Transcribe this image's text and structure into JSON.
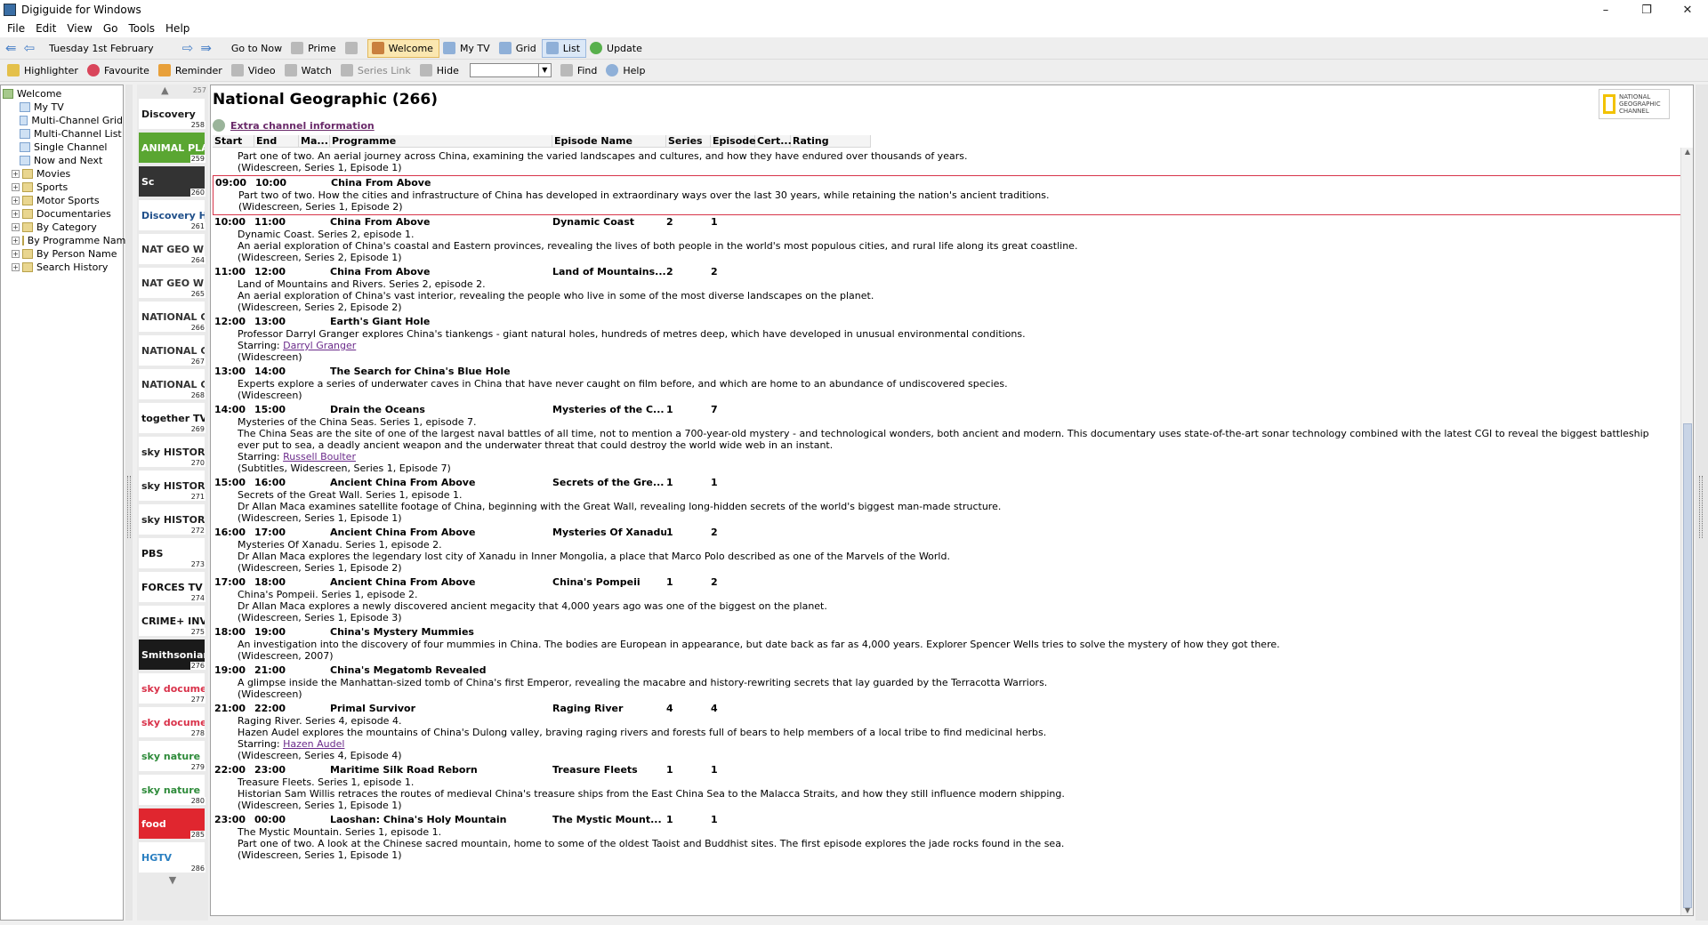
{
  "window": {
    "title": "Digiguide for Windows",
    "minimize": "–",
    "restore": "❐",
    "close": "✕"
  },
  "menu": [
    "File",
    "Edit",
    "View",
    "Go",
    "Tools",
    "Help"
  ],
  "toolbar1": {
    "date": "Tuesday 1st February",
    "go_to_now": "Go to Now",
    "prime": "Prime",
    "welcome": "Welcome",
    "my_tv": "My TV",
    "grid": "Grid",
    "list": "List",
    "update": "Update"
  },
  "toolbar2": {
    "highlighter": "Highlighter",
    "favourite": "Favourite",
    "reminder": "Reminder",
    "video": "Video",
    "watch": "Watch",
    "series_link": "Series Link",
    "hide": "Hide",
    "find": "Find",
    "help": "Help"
  },
  "tree": [
    {
      "label": "Welcome",
      "level": 0,
      "icon": "welcome",
      "exp": ""
    },
    {
      "label": "My TV",
      "level": 1,
      "icon": "page",
      "exp": ""
    },
    {
      "label": "Multi-Channel Grid",
      "level": 1,
      "icon": "page",
      "exp": ""
    },
    {
      "label": "Multi-Channel List",
      "level": 1,
      "icon": "page",
      "exp": ""
    },
    {
      "label": "Single Channel",
      "level": 1,
      "icon": "page",
      "exp": ""
    },
    {
      "label": "Now and Next",
      "level": 1,
      "icon": "page",
      "exp": ""
    },
    {
      "label": "Movies",
      "level": 0,
      "icon": "folder",
      "exp": "+"
    },
    {
      "label": "Sports",
      "level": 0,
      "icon": "folder",
      "exp": "+"
    },
    {
      "label": "Motor Sports",
      "level": 0,
      "icon": "folder",
      "exp": "+"
    },
    {
      "label": "Documentaries",
      "level": 0,
      "icon": "folder",
      "exp": "+"
    },
    {
      "label": "By Category",
      "level": 0,
      "icon": "folder",
      "exp": "+"
    },
    {
      "label": "By Programme Name",
      "level": 0,
      "icon": "folder",
      "exp": "+"
    },
    {
      "label": "By Person Name",
      "level": 0,
      "icon": "folder",
      "exp": "+"
    },
    {
      "label": "Search History",
      "level": 0,
      "icon": "folder",
      "exp": "+"
    }
  ],
  "channels": [
    {
      "num": "258",
      "logo": "Discovery",
      "color": "#1a1a1a",
      "bg": "#ffffff"
    },
    {
      "num": "259",
      "logo": "ANIMAL PLAN",
      "color": "#ffffff",
      "bg": "#5aa632"
    },
    {
      "num": "260",
      "logo": "Sc",
      "color": "#ffffff",
      "bg": "#333333"
    },
    {
      "num": "261",
      "logo": "Discovery HISTO",
      "color": "#1f4f8a",
      "bg": "#ffffff"
    },
    {
      "num": "264",
      "logo": "NAT GEO WILD",
      "color": "#333333",
      "bg": "#ffffff"
    },
    {
      "num": "265",
      "logo": "NAT GEO WILD",
      "color": "#333333",
      "bg": "#ffffff"
    },
    {
      "num": "266",
      "logo": "NATIONAL GEOGRAPHIC",
      "color": "#333333",
      "bg": "#ffffff"
    },
    {
      "num": "267",
      "logo": "NATIONAL GEOGRAPHIC",
      "color": "#333333",
      "bg": "#ffffff"
    },
    {
      "num": "268",
      "logo": "NATIONAL GEOGRAPHIC",
      "color": "#333333",
      "bg": "#ffffff"
    },
    {
      "num": "269",
      "logo": "together TV",
      "color": "#111111",
      "bg": "#ffffff"
    },
    {
      "num": "270",
      "logo": "sky HISTORY",
      "color": "#222222",
      "bg": "#ffffff"
    },
    {
      "num": "271",
      "logo": "sky HISTORY",
      "color": "#222222",
      "bg": "#ffffff"
    },
    {
      "num": "272",
      "logo": "sky HISTORY",
      "color": "#222222",
      "bg": "#ffffff"
    },
    {
      "num": "273",
      "logo": "PBS",
      "color": "#111111",
      "bg": "#ffffff"
    },
    {
      "num": "274",
      "logo": "FORCES TV",
      "color": "#111111",
      "bg": "#ffffff"
    },
    {
      "num": "275",
      "logo": "CRIME+ INVESTIGATION",
      "color": "#111111",
      "bg": "#ffffff"
    },
    {
      "num": "276",
      "logo": "Smithsonian",
      "color": "#ffffff",
      "bg": "#1a1a1a"
    },
    {
      "num": "277",
      "logo": "sky documentaries",
      "color": "#d9324a",
      "bg": "#ffffff"
    },
    {
      "num": "278",
      "logo": "sky documentaries",
      "color": "#d9324a",
      "bg": "#ffffff"
    },
    {
      "num": "279",
      "logo": "sky nature",
      "color": "#2e8b3a",
      "bg": "#ffffff"
    },
    {
      "num": "280",
      "logo": "sky nature",
      "color": "#2e8b3a",
      "bg": "#ffffff"
    },
    {
      "num": "285",
      "logo": "food",
      "color": "#ffffff",
      "bg": "#e0262f"
    },
    {
      "num": "286",
      "logo": "HGTV",
      "color": "#2a7fc1",
      "bg": "#ffffff"
    }
  ],
  "channel_partial_top": "257",
  "main": {
    "title": "National Geographic (266)",
    "badge": "NATIONAL GEOGRAPHIC CHANNEL",
    "extra_info": "Extra channel information",
    "columns": [
      "Start",
      "End",
      "Ma...",
      "Programme",
      "Episode Name",
      "Series",
      "Episode",
      "Cert...",
      "Rating"
    ]
  },
  "programmes": [
    {
      "start": "",
      "end": "",
      "title": "",
      "episode": "",
      "series": "",
      "ep": "",
      "lines": [
        "Part one of two. An aerial journey across China, examining the varied landscapes and cultures, and how they have endured over thousands of years.",
        "(Widescreen, Series 1, Episode 1)"
      ],
      "starring": "",
      "selected": false
    },
    {
      "start": "09:00",
      "end": "10:00",
      "title": "China From Above",
      "episode": "",
      "series": "",
      "ep": "",
      "lines": [
        "Part two of two. How the cities and infrastructure of China has developed in extraordinary ways over the last 30 years, while retaining the nation's ancient traditions.",
        "(Widescreen, Series 1, Episode 2)"
      ],
      "starring": "",
      "selected": true
    },
    {
      "start": "10:00",
      "end": "11:00",
      "title": "China From Above",
      "episode": "Dynamic Coast",
      "series": "2",
      "ep": "1",
      "lines": [
        "Dynamic Coast. Series 2, episode 1.",
        "An aerial exploration of China's coastal and Eastern provinces, revealing the lives of both people in the world's most populous cities, and rural life along its great coastline.",
        "(Widescreen, Series 2, Episode 1)"
      ],
      "starring": "",
      "selected": false
    },
    {
      "start": "11:00",
      "end": "12:00",
      "title": "China From Above",
      "episode": "Land of Mountains...",
      "series": "2",
      "ep": "2",
      "lines": [
        "Land of Mountains and Rivers. Series 2, episode 2.",
        "An aerial exploration of China's vast interior, revealing the people who live in some of the most diverse landscapes on the planet.",
        "(Widescreen, Series 2, Episode 2)"
      ],
      "starring": "",
      "selected": false
    },
    {
      "start": "12:00",
      "end": "13:00",
      "title": "Earth's Giant Hole",
      "episode": "",
      "series": "",
      "ep": "",
      "lines": [
        "Professor Darryl Granger explores China's tiankengs - giant natural holes, hundreds of metres deep, which have developed in unusual environmental conditions."
      ],
      "starring": "Darryl Granger",
      "tail": "(Widescreen)",
      "selected": false
    },
    {
      "start": "13:00",
      "end": "14:00",
      "title": "The Search for China's Blue Hole",
      "episode": "",
      "series": "",
      "ep": "",
      "lines": [
        "Experts explore a series of underwater caves in China that have never caught on film before, and which are home to an abundance of undiscovered species.",
        "(Widescreen)"
      ],
      "starring": "",
      "selected": false
    },
    {
      "start": "14:00",
      "end": "15:00",
      "title": "Drain the Oceans",
      "episode": "Mysteries of the C...",
      "series": "1",
      "ep": "7",
      "lines": [
        "Mysteries of the China Seas. Series 1, episode 7.",
        "The China Seas are the site of one of the largest naval battles of all time, not to mention a 700-year-old mystery - and technological wonders, both ancient and modern. This documentary uses state-of-the-art sonar technology combined with the latest CGI to reveal the biggest battleship ever put to sea, a deadly ancient weapon and the underwater threat that could destroy the world wide web in an instant."
      ],
      "starring": "Russell Boulter",
      "tail": "(Subtitles, Widescreen, Series 1, Episode 7)",
      "selected": false
    },
    {
      "start": "15:00",
      "end": "16:00",
      "title": "Ancient China From Above",
      "episode": "Secrets of the Gre...",
      "series": "1",
      "ep": "1",
      "lines": [
        "Secrets of the Great Wall. Series 1, episode 1.",
        "Dr Allan Maca examines satellite footage of China, beginning with the Great Wall, revealing long-hidden secrets of the world's biggest man-made structure.",
        "(Widescreen, Series 1, Episode 1)"
      ],
      "starring": "",
      "selected": false
    },
    {
      "start": "16:00",
      "end": "17:00",
      "title": "Ancient China From Above",
      "episode": "Mysteries Of Xanadu",
      "series": "1",
      "ep": "2",
      "lines": [
        "Mysteries Of Xanadu. Series 1, episode 2.",
        "Dr Allan Maca explores the legendary lost city of Xanadu in Inner Mongolia, a place that Marco Polo described as one of the Marvels of the World.",
        "(Widescreen, Series 1, Episode 2)"
      ],
      "starring": "",
      "selected": false
    },
    {
      "start": "17:00",
      "end": "18:00",
      "title": "Ancient China From Above",
      "episode": "China's Pompeii",
      "series": "1",
      "ep": "2",
      "lines": [
        "China's Pompeii. Series 1, episode 2.",
        "Dr Allan Maca explores a newly discovered ancient megacity that 4,000 years ago was one of the biggest on the planet.",
        "(Widescreen, Series 1, Episode 3)"
      ],
      "starring": "",
      "selected": false
    },
    {
      "start": "18:00",
      "end": "19:00",
      "title": "China's Mystery Mummies",
      "episode": "",
      "series": "",
      "ep": "",
      "lines": [
        "An investigation into the discovery of four mummies in China. The bodies are European in appearance, but date back as far as 4,000 years. Explorer Spencer Wells tries to solve the mystery of how they got there.",
        "(Widescreen, 2007)"
      ],
      "starring": "",
      "selected": false
    },
    {
      "start": "19:00",
      "end": "21:00",
      "title": "China's Megatomb Revealed",
      "episode": "",
      "series": "",
      "ep": "",
      "lines": [
        "A glimpse inside the Manhattan-sized tomb of China's first Emperor, revealing the macabre and history-rewriting secrets that lay guarded by the Terracotta Warriors.",
        "(Widescreen)"
      ],
      "starring": "",
      "selected": false
    },
    {
      "start": "21:00",
      "end": "22:00",
      "title": "Primal Survivor",
      "episode": "Raging River",
      "series": "4",
      "ep": "4",
      "lines": [
        "Raging River. Series 4, episode 4.",
        "Hazen Audel explores the mountains of China's Dulong valley, braving raging rivers and forests full of bears to help members of a local tribe to find medicinal herbs."
      ],
      "starring": "Hazen Audel",
      "tail": "(Widescreen, Series 4, Episode 4)",
      "selected": false
    },
    {
      "start": "22:00",
      "end": "23:00",
      "title": "Maritime Silk Road Reborn",
      "episode": "Treasure Fleets",
      "series": "1",
      "ep": "1",
      "lines": [
        "Treasure Fleets. Series 1, episode 1.",
        "Historian Sam Willis retraces the routes of medieval China's treasure ships from the East China Sea to the Malacca Straits, and how they still influence modern shipping.",
        "(Widescreen, Series 1, Episode 1)"
      ],
      "starring": "",
      "selected": false
    },
    {
      "start": "23:00",
      "end": "00:00",
      "title": "Laoshan: China's Holy Mountain",
      "episode": "The Mystic Mount...",
      "series": "1",
      "ep": "1",
      "lines": [
        "The Mystic Mountain. Series 1, episode 1.",
        "Part one of two. A look at the Chinese sacred mountain, home to some of the oldest Taoist and Buddhist sites. The first episode explores the jade rocks found in the sea.",
        "(Widescreen, Series 1, Episode 1)"
      ],
      "starring": "",
      "selected": false
    }
  ],
  "starring_label": "Starring: "
}
